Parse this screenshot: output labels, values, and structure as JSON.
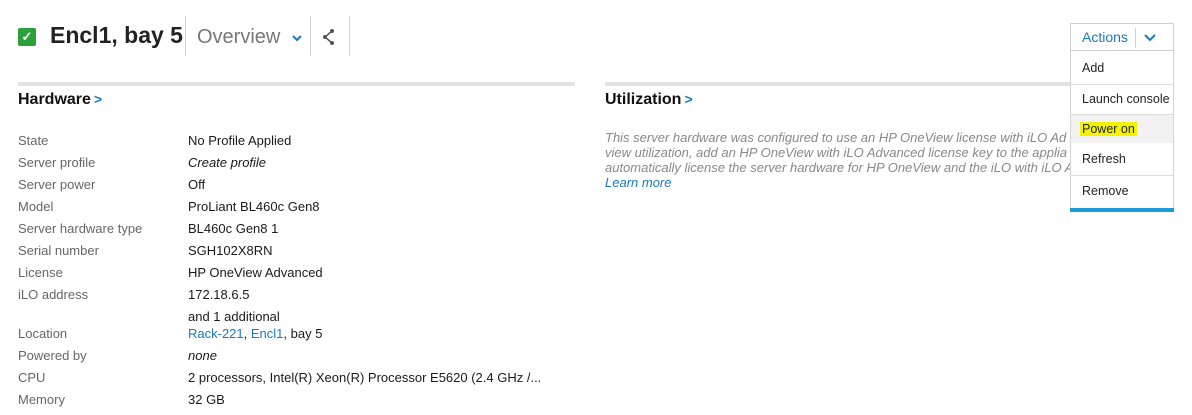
{
  "header": {
    "title": "Encl1, bay 5",
    "view": "Overview"
  },
  "actions": {
    "label": "Actions",
    "items": [
      "Add",
      "Launch console",
      "Power on",
      "Refresh",
      "Remove"
    ]
  },
  "hardware": {
    "title": "Hardware",
    "arrow": ">",
    "rows": [
      {
        "label": "State",
        "value": "No Profile Applied"
      },
      {
        "label": "Server profile",
        "value": "Create profile"
      },
      {
        "label": "Server power",
        "value": "Off"
      },
      {
        "label": "Model",
        "value": "ProLiant BL460c Gen8"
      },
      {
        "label": "Server hardware type",
        "value": "BL460c Gen8 1"
      },
      {
        "label": "Serial number",
        "value": "SGH102X8RN"
      },
      {
        "label": "License",
        "value": "HP OneView Advanced"
      },
      {
        "label": "iLO address",
        "value": "172.18.6.5",
        "extra": "and 1 additional"
      },
      {
        "label": "Location",
        "value_parts": [
          "Rack-221",
          ", ",
          "Encl1",
          ", bay 5"
        ]
      },
      {
        "label": "Powered by",
        "value": "none"
      },
      {
        "label": "CPU",
        "value": "2 processors, Intel(R) Xeon(R) Processor E5620 (2.4 GHz /..."
      },
      {
        "label": "Memory",
        "value": "32 GB"
      }
    ]
  },
  "utilization": {
    "title": "Utilization",
    "arrow": ">",
    "lines": [
      "This server hardware was configured to use an HP OneView license with iLO Ad",
      "view utilization, add an HP OneView with iLO Advanced license key to the applia",
      "automatically license the server hardware for HP OneView and the iLO with iLO A"
    ],
    "learn_more": "Learn more"
  },
  "colors": {
    "accent": "#1a7abf",
    "status_ok": "#2aa13a",
    "highlight": "#f4f400",
    "menu_bottom_bar": "#1a9ad6"
  },
  "icons": {
    "status": "check-icon",
    "view_dropdown": "chevron-down-icon",
    "share": "share-icon",
    "actions_dropdown": "chevron-down-icon"
  }
}
